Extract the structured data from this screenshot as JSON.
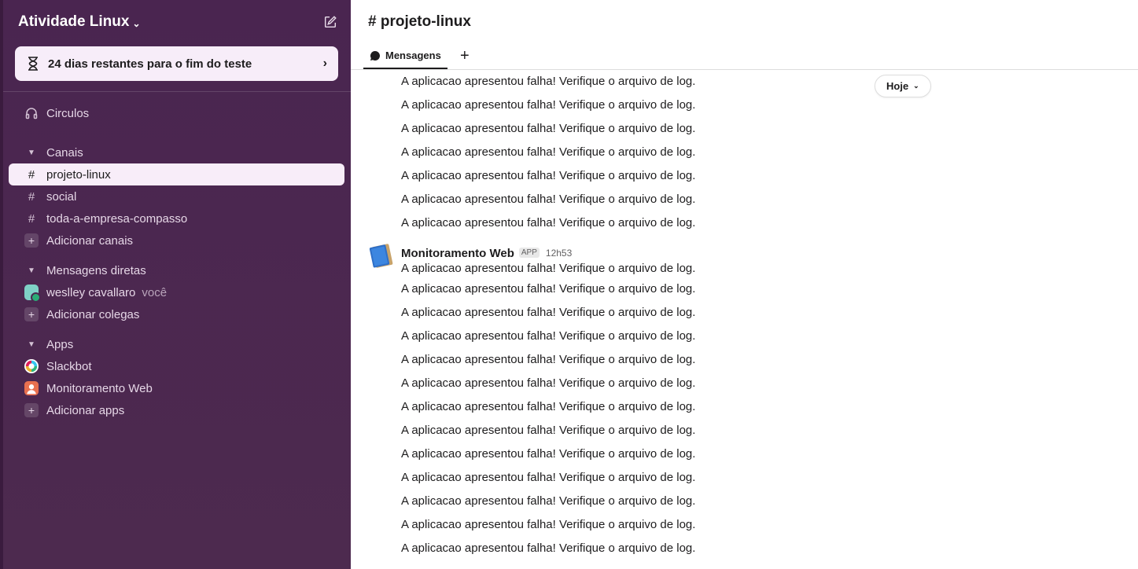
{
  "workspace": {
    "name": "Atividade Linux",
    "trial_banner": "24 dias restantes para o fim do teste"
  },
  "sidebar": {
    "huddles_label": "Circulos",
    "channels_header": "Canais",
    "channels": [
      "projeto-linux",
      "social",
      "toda-a-empresa-compasso"
    ],
    "add_channels": "Adicionar canais",
    "dm_header": "Mensagens diretas",
    "dm_user": "weslley cavallaro",
    "dm_you": "você",
    "add_colleagues": "Adicionar colegas",
    "apps_header": "Apps",
    "apps": [
      "Slackbot",
      "Monitoramento Web"
    ],
    "add_apps": "Adicionar apps"
  },
  "channel": {
    "name": "# projeto-linux",
    "tab_messages": "Mensagens",
    "date_pill": "Hoje"
  },
  "messages": {
    "text": "A aplicacao apresentou falha! Verifique o arquivo de log.",
    "sender": "Monitoramento Web",
    "app_badge": "APP",
    "time": "12h53"
  },
  "colors": {
    "sidebar_bg": "#4a2550",
    "active_item_bg": "#f8edf9",
    "banner_bg": "#f7edf9",
    "presence": "#2bac76"
  }
}
